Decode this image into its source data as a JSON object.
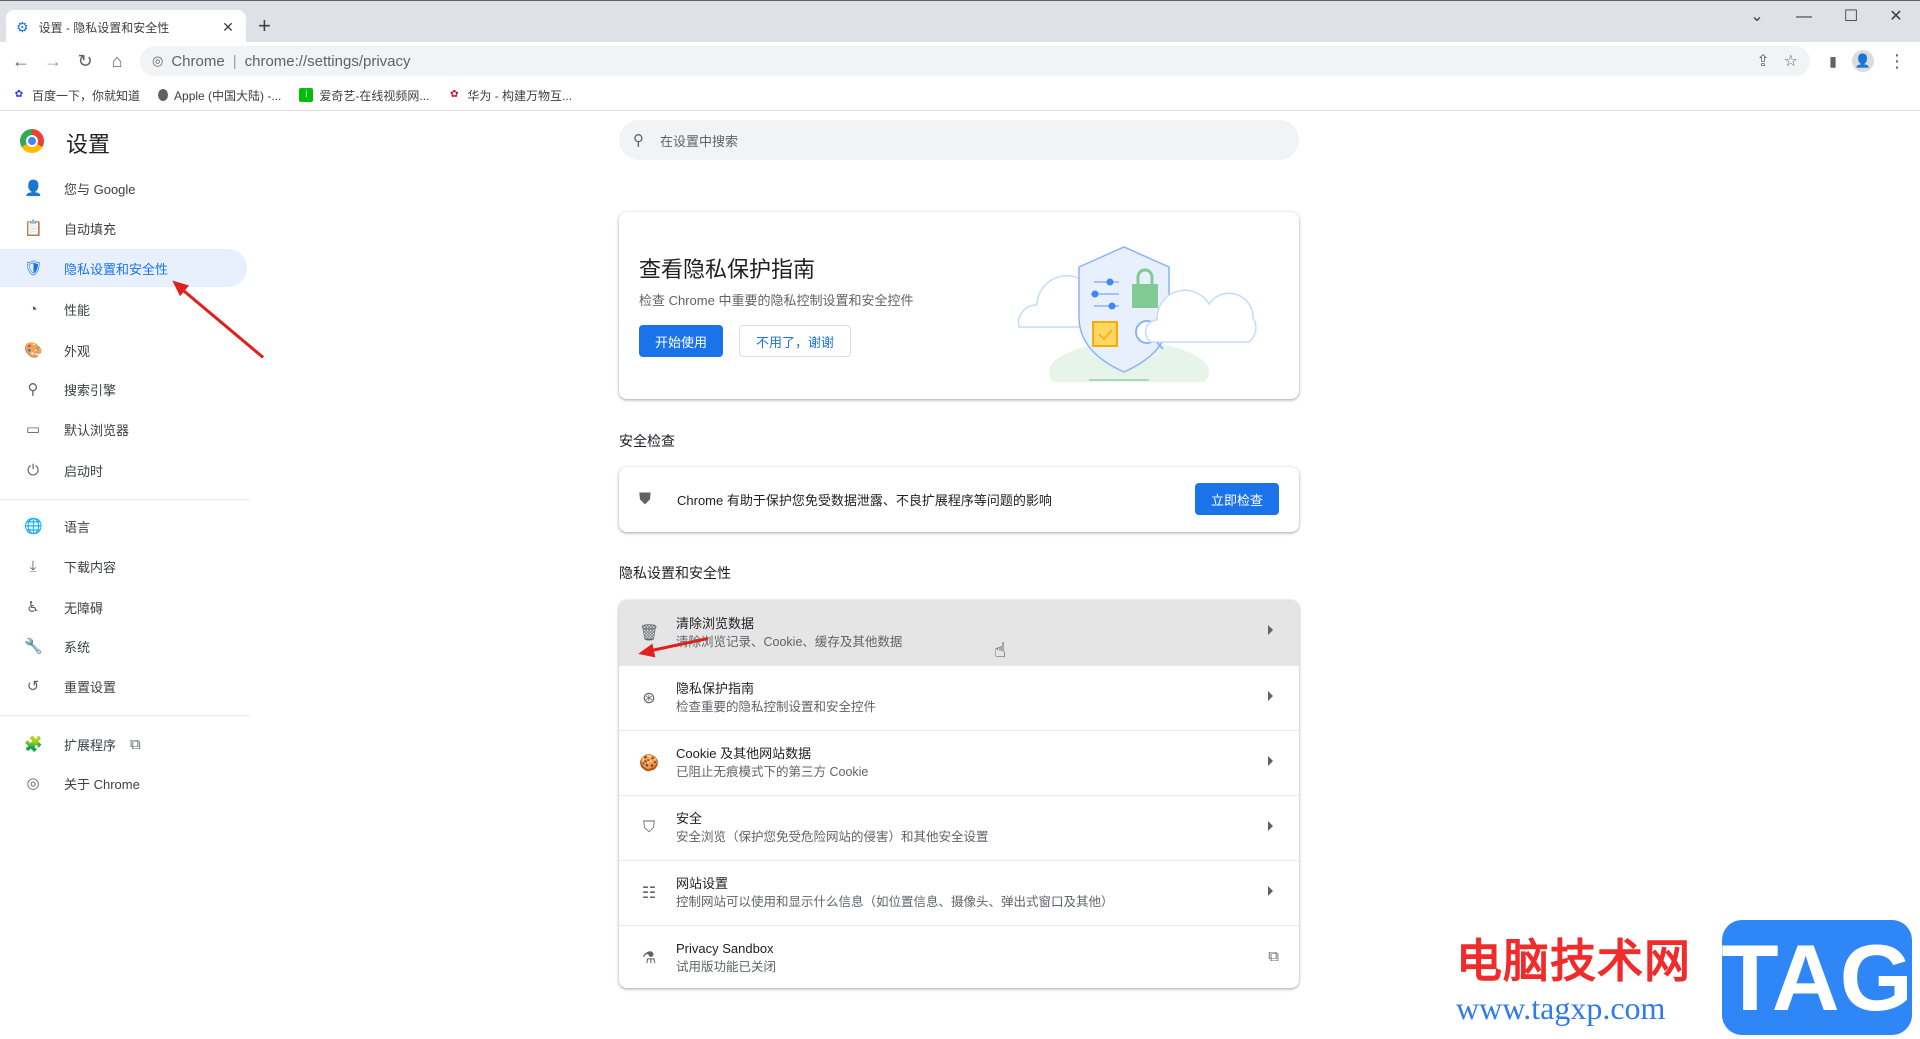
{
  "browser": {
    "tab_title": "设置 - 隐私设置和安全性",
    "tab_close": "✕",
    "new_tab": "+",
    "window_controls": {
      "tab_search": "⌄",
      "minimize": "—",
      "maximize": "☐",
      "close": "✕"
    },
    "nav": {
      "back": "←",
      "forward": "→",
      "reload": "↻",
      "home": "⌂"
    },
    "omnibox": {
      "site_label": "Chrome",
      "separator": "|",
      "url": "chrome://settings/privacy"
    },
    "toolbar_icons": {
      "share": "⇪",
      "bookmark_star": "☆",
      "side_panel": "▮",
      "profile": "👤",
      "menu": "⋮"
    },
    "bookmarks": [
      {
        "label": "百度一下，你就知道",
        "icon": "baidu-icon",
        "color": "#2932e1",
        "glyph": "✿"
      },
      {
        "label": "Apple (中国大陆) -...",
        "icon": "apple-icon",
        "color": "#ffffff",
        "glyph": ""
      },
      {
        "label": "爱奇艺-在线视频网...",
        "icon": "iqiyi-icon",
        "color": "#00be06",
        "glyph": "i"
      },
      {
        "label": "华为 - 构建万物互...",
        "icon": "huawei-icon",
        "color": "#cf0a2c",
        "glyph": "✿"
      }
    ]
  },
  "sidebar": {
    "title": "设置",
    "items": [
      {
        "label": "您与 Google",
        "icon": "person-icon",
        "glyph": "👤"
      },
      {
        "label": "自动填充",
        "icon": "clipboard-icon",
        "glyph": "📋"
      },
      {
        "label": "隐私设置和安全性",
        "icon": "shield-icon",
        "glyph": "🛡",
        "active": true
      },
      {
        "label": "性能",
        "icon": "speedometer-icon",
        "glyph": "◔"
      },
      {
        "label": "外观",
        "icon": "palette-icon",
        "glyph": "🎨"
      },
      {
        "label": "搜索引擎",
        "icon": "search-icon",
        "glyph": "⚲"
      },
      {
        "label": "默认浏览器",
        "icon": "browser-window-icon",
        "glyph": "▭"
      },
      {
        "label": "启动时",
        "icon": "power-icon",
        "glyph": "⏻"
      },
      {
        "label": "语言",
        "icon": "globe-icon",
        "glyph": "🌐"
      },
      {
        "label": "下载内容",
        "icon": "download-icon",
        "glyph": "⤓"
      },
      {
        "label": "无障碍",
        "icon": "accessibility-icon",
        "glyph": "♿"
      },
      {
        "label": "系统",
        "icon": "wrench-icon",
        "glyph": "🔧"
      },
      {
        "label": "重置设置",
        "icon": "history-icon",
        "glyph": "↺"
      },
      {
        "label": "扩展程序",
        "icon": "puzzle-icon",
        "glyph": "🧩",
        "external": "⧉"
      },
      {
        "label": "关于 Chrome",
        "icon": "chrome-icon",
        "glyph": "◎"
      }
    ]
  },
  "search": {
    "placeholder": "在设置中搜索",
    "icon": "⚲"
  },
  "guide_card": {
    "title": "查看隐私保护指南",
    "description": "检查 Chrome 中重要的隐私控制设置和安全控件",
    "start_label": "开始使用",
    "skip_label": "不用了，谢谢"
  },
  "safety_check": {
    "section_label": "安全检查",
    "text": "Chrome 有助于保护您免受数据泄露、不良扩展程序等问题的影响",
    "button_label": "立即检查",
    "icon": "✔"
  },
  "privacy_section": {
    "section_label": "隐私设置和安全性",
    "rows": [
      {
        "title": "清除浏览数据",
        "subtitle": "清除浏览记录、Cookie、缓存及其他数据",
        "icon": "trash-icon",
        "glyph": "🗑",
        "trailing": "arrow"
      },
      {
        "title": "隐私保护指南",
        "subtitle": "检查重要的隐私控制设置和安全控件",
        "icon": "compass-icon",
        "glyph": "⊛",
        "trailing": "arrow"
      },
      {
        "title": "Cookie 及其他网站数据",
        "subtitle": "已阻止无痕模式下的第三方 Cookie",
        "icon": "cookie-icon",
        "glyph": "🍪",
        "trailing": "arrow"
      },
      {
        "title": "安全",
        "subtitle": "安全浏览（保护您免受危险网站的侵害）和其他安全设置",
        "icon": "security-shield-icon",
        "glyph": "⛉",
        "trailing": "arrow"
      },
      {
        "title": "网站设置",
        "subtitle": "控制网站可以使用和显示什么信息（如位置信息、摄像头、弹出式窗口及其他）",
        "icon": "tune-icon",
        "glyph": "☷",
        "trailing": "arrow"
      },
      {
        "title": "Privacy Sandbox",
        "subtitle": "试用版功能已关闭",
        "icon": "flask-icon",
        "glyph": "⚗",
        "trailing": "external",
        "external_glyph": "⧉"
      }
    ]
  },
  "watermark": {
    "text": "电脑技术网",
    "url": "www.tagxp.com",
    "tag": "TAG"
  },
  "colors": {
    "accent": "#1a73e8",
    "active_bg": "#e8f0fe",
    "hover_row": "#e5e5e5",
    "annotation_red": "#e0201a"
  }
}
